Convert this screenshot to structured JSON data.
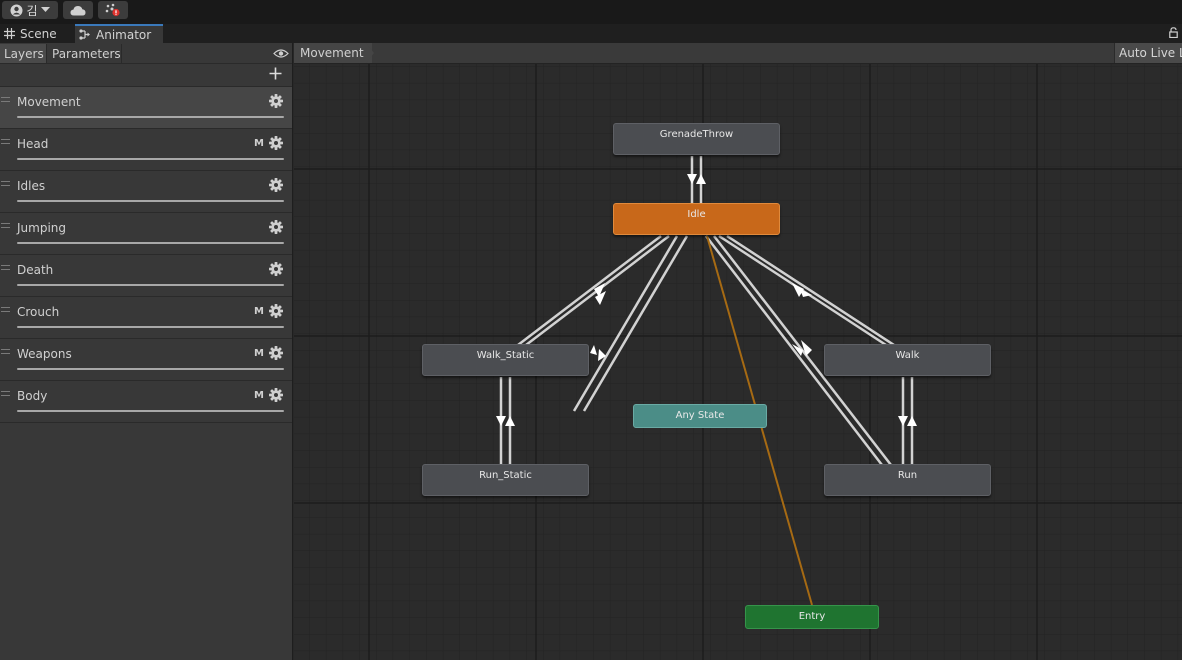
{
  "topbar": {
    "account_label": "김",
    "icons": [
      "account-icon",
      "dropdown-arrow-icon",
      "cloud-icon",
      "collab-icon"
    ]
  },
  "tabs": [
    {
      "label": "Scene",
      "icon": "grid-icon",
      "active": false
    },
    {
      "label": "Animator",
      "icon": "animator-icon",
      "active": true
    }
  ],
  "left_panel": {
    "subtabs": [
      "Layers",
      "Parameters"
    ],
    "layers": [
      {
        "name": "Movement",
        "mask": "",
        "selected": true
      },
      {
        "name": "Head",
        "mask": "M",
        "selected": false
      },
      {
        "name": "Idles",
        "mask": "",
        "selected": false
      },
      {
        "name": "Jumping",
        "mask": "",
        "selected": false
      },
      {
        "name": "Death",
        "mask": "",
        "selected": false
      },
      {
        "name": "Crouch",
        "mask": "M",
        "selected": false
      },
      {
        "name": "Weapons",
        "mask": "M",
        "selected": false
      },
      {
        "name": "Body",
        "mask": "M",
        "selected": false
      }
    ]
  },
  "graph": {
    "breadcrumb": "Movement",
    "auto_live_label": "Auto Live L",
    "states": [
      {
        "label": "GrenadeThrow",
        "kind": "normal"
      },
      {
        "label": "Idle",
        "kind": "default"
      },
      {
        "label": "Walk_Static",
        "kind": "normal"
      },
      {
        "label": "Walk",
        "kind": "normal"
      },
      {
        "label": "Any State",
        "kind": "any"
      },
      {
        "label": "Run_Static",
        "kind": "normal"
      },
      {
        "label": "Run",
        "kind": "normal"
      },
      {
        "label": "Entry",
        "kind": "entry"
      }
    ]
  },
  "colors": {
    "default_state": "#c8681a",
    "any_state": "#4b8d87",
    "entry": "#1f7430",
    "state": "#4b4d51",
    "tab_accent": "#3a79bb",
    "entry_transition": "#a66a13"
  }
}
